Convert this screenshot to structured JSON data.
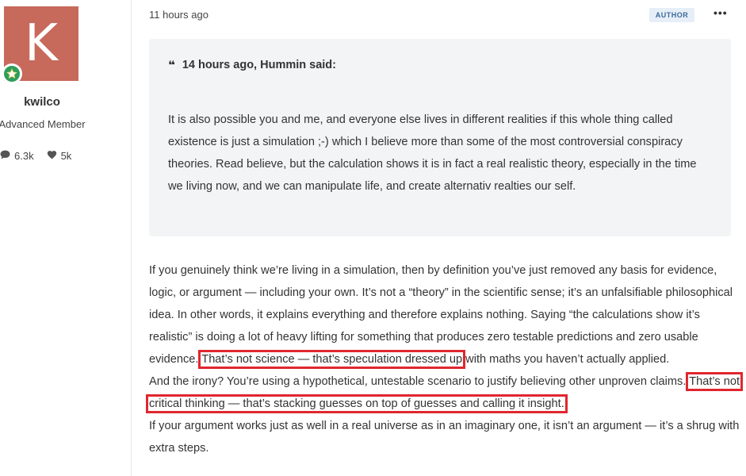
{
  "author": {
    "avatar_letter": "K",
    "name": "kwilco",
    "rank": "Advanced Member",
    "posts_count": "6.3k",
    "reputation_count": "5k",
    "avatar_color": "#c7695b",
    "badge_color": "#2e9e5a"
  },
  "post": {
    "time": "11 hours ago",
    "author_badge": "AUTHOR",
    "more_label": "•••",
    "quote": {
      "mark": "❝",
      "header": "14 hours ago, Hummin said:",
      "body": "It is also possible you and me, and everyone else lives in different realities if this whole thing called existence is just a simulation ;-) which I believe more than some of the most controversial conspiracy theories. Read believe, but the calculation shows it is in fact a real realistic theory, especially in the time we living now, and we can manipulate life, and create alternativ realties our self."
    },
    "paragraph1_a": "If you genuinely think we’re living in a simulation, then by definition you’ve just removed any basis for evidence, logic, or argument — including your own. It’s not a “theory” in the scientific sense; it’s an unfalsifiable philosophical idea. In other words, it explains everything and therefore explains nothing. Saying “the calculations show it’s realistic” is doing a lot of heavy lifting for something that produces zero testable predictions and zero usable evidence.",
    "paragraph1_highlight": "That’s not science — that’s speculation dressed up",
    "paragraph1_b": "with maths you haven’t actually applied.",
    "paragraph2_a": "And the irony? You’re using a hypothetical, untestable scenario to justify believing other unproven claims.",
    "paragraph2_highlight": "That’s not critical thinking — that’s stacking guesses on top of guesses and calling it insight.",
    "paragraph3": "If your argument works just as well in a real universe as in an imaginary one, it isn’t an argument — it’s a shrug with extra steps."
  }
}
